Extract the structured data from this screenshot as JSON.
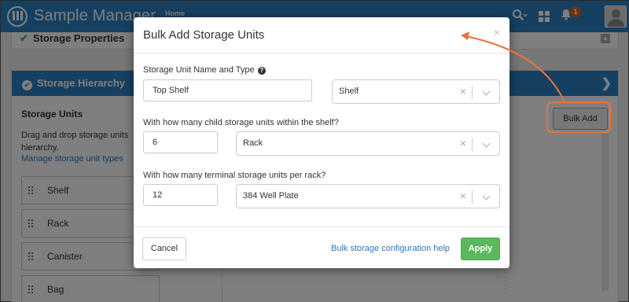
{
  "app": {
    "title": "Sample Manager",
    "breadcrumb": "Home",
    "notification_count": "1",
    "icons": [
      "search-icon",
      "apps-grid-icon",
      "bell-icon",
      "user-avatar"
    ]
  },
  "props_panel": {
    "title": "Storage Properties"
  },
  "hierarchy": {
    "title": "Storage Hierarchy",
    "units_heading": "Storage Units",
    "instructions": "Drag and drop storage units to build your hierarchy.",
    "instructions_visible": "Drag and drop storage units",
    "instructions_line2": "hierarchy.",
    "manage_link": "Manage storage unit types",
    "items": [
      {
        "label": "Shelf"
      },
      {
        "label": "Rack"
      },
      {
        "label": "Canister"
      },
      {
        "label": "Bag"
      }
    ],
    "bulk_add_label": "Bulk Add"
  },
  "modal": {
    "title": "Bulk Add Storage Units",
    "close_glyph": "×",
    "field1_label": "Storage Unit Name and Type",
    "field1_name_value": "Top Shelf",
    "field1_type_value": "Shelf",
    "field2_label": "With how many child storage units within the shelf?",
    "field2_count_value": "6",
    "field2_type_value": "Rack",
    "field3_label": "With how many terminal storage units per rack?",
    "field3_count_value": "12",
    "field3_type_value": "384 Well Plate",
    "clear_glyph": "×",
    "cancel_label": "Cancel",
    "help_link_label": "Bulk storage configuration help",
    "apply_label": "Apply"
  },
  "colors": {
    "brand": "#2c80c2",
    "apply_green": "#5cb85c",
    "highlight_orange": "#e8733a",
    "link_blue": "#2b78c2"
  }
}
